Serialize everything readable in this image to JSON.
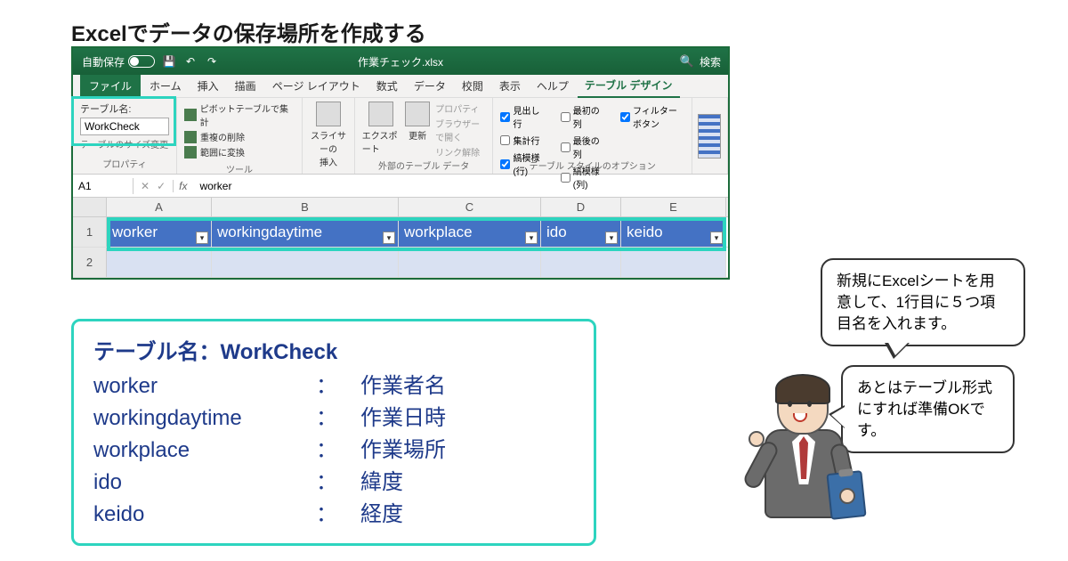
{
  "title": "Excelでデータの保存場所を作成する",
  "titlebar": {
    "autosave": "自動保存",
    "autosave_state": "オフ",
    "filename": "作業チェック.xlsx",
    "search": "検索"
  },
  "menu": {
    "file": "ファイル",
    "home": "ホーム",
    "insert": "挿入",
    "draw": "描画",
    "pagelayout": "ページ レイアウト",
    "formulas": "数式",
    "data": "データ",
    "review": "校閲",
    "view": "表示",
    "help": "ヘルプ",
    "tabledesign": "テーブル デザイン"
  },
  "ribbon": {
    "props": {
      "label": "テーブル名:",
      "value": "WorkCheck",
      "resize": "テーブルのサイズ変更",
      "group": "プロパティ"
    },
    "tools": {
      "pivot": "ピボットテーブルで集計",
      "dedup": "重複の削除",
      "range": "範囲に変換",
      "slicer": "スライサーの\n挿入",
      "group": "ツール"
    },
    "ext": {
      "export": "エクスポート",
      "refresh": "更新",
      "prop": "プロパティ",
      "browser": "ブラウザーで開く",
      "unlink": "リンク解除",
      "group": "外部のテーブル データ"
    },
    "opts": {
      "header": "見出し行",
      "total": "集計行",
      "banded_r": "縞模様 (行)",
      "first": "最初の列",
      "last": "最後の列",
      "banded_c": "縞模様 (列)",
      "filter": "フィルター ボタン",
      "group": "テーブル スタイルのオプション"
    }
  },
  "formula": {
    "cell": "A1",
    "value": "worker"
  },
  "columns": [
    "A",
    "B",
    "C",
    "D",
    "E"
  ],
  "headers": [
    "worker",
    "workingdaytime",
    "workplace",
    "ido",
    "keido"
  ],
  "legend": {
    "title": "テーブル名：WorkCheck",
    "rows": [
      {
        "k": "worker",
        "v": "作業者名"
      },
      {
        "k": "workingdaytime",
        "v": "作業日時"
      },
      {
        "k": "workplace",
        "v": "作業場所"
      },
      {
        "k": "ido",
        "v": "緯度"
      },
      {
        "k": "keido",
        "v": "経度"
      }
    ]
  },
  "bubble1": "新規にExcelシートを用意して、1行目に５つ項目名を入れます。",
  "bubble2": "あとはテーブル形式にすれば準備OKです。"
}
